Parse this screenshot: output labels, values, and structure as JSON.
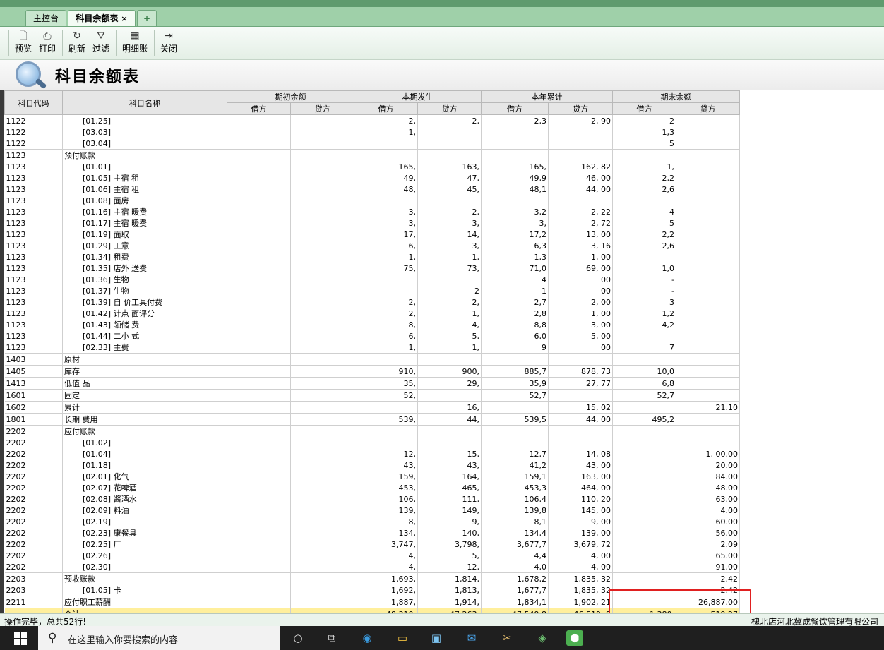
{
  "tabs": [
    {
      "label": "主控台"
    },
    {
      "label": "科目余额表",
      "close": "×"
    },
    {
      "label": "+"
    }
  ],
  "toolbar": {
    "preview": "预览",
    "print": "打印",
    "refresh": "刷新",
    "filter": "过滤",
    "detail": "明细账",
    "close": "关闭"
  },
  "page_title": "科目余额表",
  "table": {
    "head": {
      "code": "科目代码",
      "name": "科目名称",
      "opening": "期初余额",
      "period": "本期发生",
      "ytd": "本年累计",
      "closing": "期末余额",
      "debit": "借方",
      "credit": "贷方"
    },
    "rows": [
      {
        "code": "1122",
        "name": "[01.25]",
        "od": "",
        "oc": "",
        "pd": "2,",
        "pc": "2,",
        "yd": "2,3",
        "yc": "2,   90",
        "cd": "2",
        "cc": ""
      },
      {
        "code": "1122",
        "name": "[03.03]",
        "od": "",
        "oc": "",
        "pd": "1,",
        "pc": "",
        "yd": "",
        "yc": "",
        "cd": "1,3",
        "cc": ""
      },
      {
        "code": "1122",
        "name": "[03.04]",
        "od": "",
        "oc": "",
        "pd": "",
        "pc": "",
        "yd": "",
        "yc": "",
        "cd": "5",
        "cc": ""
      },
      {
        "code": "1123",
        "name": "预付账款",
        "grp": true,
        "od": "",
        "oc": "",
        "pd": "",
        "pc": "",
        "yd": "",
        "yc": "",
        "cd": "",
        "cc": ""
      },
      {
        "code": "1123",
        "name": "[01.01]",
        "od": "",
        "oc": "",
        "pd": "165,",
        "pc": "163,",
        "yd": "165,",
        "yc": "162,   82",
        "cd": "1,",
        "cc": ""
      },
      {
        "code": "1123",
        "name": "[01.05]  主宿    租",
        "od": "",
        "oc": "",
        "pd": "49,",
        "pc": "47,",
        "yd": "49,9",
        "yc": "46,   00",
        "cd": "2,2",
        "cc": ""
      },
      {
        "code": "1123",
        "name": "[01.06]  主宿    租",
        "od": "",
        "oc": "",
        "pd": "48,",
        "pc": "45,",
        "yd": "48,1",
        "yc": "44,   00",
        "cd": "2,6",
        "cc": ""
      },
      {
        "code": "1123",
        "name": "[01.08]  面房",
        "od": "",
        "oc": "",
        "pd": "",
        "pc": "",
        "yd": "",
        "yc": "",
        "cd": "",
        "cc": ""
      },
      {
        "code": "1123",
        "name": "[01.16]  主宿    暖费",
        "od": "",
        "oc": "",
        "pd": "3,",
        "pc": "2,",
        "yd": "3,2",
        "yc": "2,   22",
        "cd": "4",
        "cc": ""
      },
      {
        "code": "1123",
        "name": "[01.17]  主宿    暖费",
        "od": "",
        "oc": "",
        "pd": "3,",
        "pc": "3,",
        "yd": "3,",
        "yc": "2,   72",
        "cd": "5",
        "cc": ""
      },
      {
        "code": "1123",
        "name": "[01.19]  面取",
        "od": "",
        "oc": "",
        "pd": "17,",
        "pc": "14,",
        "yd": "17,2",
        "yc": "13,   00",
        "cd": "2,2",
        "cc": ""
      },
      {
        "code": "1123",
        "name": "[01.29]  工意",
        "od": "",
        "oc": "",
        "pd": "6,",
        "pc": "3,",
        "yd": "6,3",
        "yc": "3,   16",
        "cd": "2,6",
        "cc": ""
      },
      {
        "code": "1123",
        "name": "[01.34]  租费",
        "od": "",
        "oc": "",
        "pd": "1,",
        "pc": "1,",
        "yd": "1,3",
        "yc": "1,   00",
        "cd": "",
        "cc": ""
      },
      {
        "code": "1123",
        "name": "[01.35]  店外    送费",
        "od": "",
        "oc": "",
        "pd": "75,",
        "pc": "73,",
        "yd": "71,0",
        "yc": "69,   00",
        "cd": "1,0",
        "cc": ""
      },
      {
        "code": "1123",
        "name": "[01.36]  生物",
        "od": "",
        "oc": "",
        "pd": "",
        "pc": "",
        "yd": "4",
        "yc": "   00",
        "cd": "-",
        "cc": ""
      },
      {
        "code": "1123",
        "name": "[01.37]  生物",
        "od": "",
        "oc": "",
        "pd": "",
        "pc": "2",
        "yd": "1",
        "yc": "   00",
        "cd": "-",
        "cc": ""
      },
      {
        "code": "1123",
        "name": "[01.39]  自    价工具付费",
        "od": "",
        "oc": "",
        "pd": "2,",
        "pc": "2,",
        "yd": "2,7",
        "yc": "2,   00",
        "cd": "3",
        "cc": ""
      },
      {
        "code": "1123",
        "name": "[01.42]  计点    面评分",
        "od": "",
        "oc": "",
        "pd": "2,",
        "pc": "1,",
        "yd": "2,8",
        "yc": "1,   00",
        "cd": "1,2",
        "cc": ""
      },
      {
        "code": "1123",
        "name": "[01.43]  领储    费",
        "od": "",
        "oc": "",
        "pd": "8,",
        "pc": "4,",
        "yd": "8,8",
        "yc": "3,   00",
        "cd": "4,2",
        "cc": ""
      },
      {
        "code": "1123",
        "name": "[01.44]  二小    式",
        "od": "",
        "oc": "",
        "pd": "6,",
        "pc": "5,",
        "yd": "6,0",
        "yc": "5,   00",
        "cd": "",
        "cc": ""
      },
      {
        "code": "1123",
        "name": "[02.33]  主费",
        "od": "",
        "oc": "",
        "pd": "1,",
        "pc": "1,",
        "yd": "9",
        "yc": "   00",
        "cd": "7",
        "cc": ""
      },
      {
        "code": "1403",
        "name": "原材",
        "grp": true,
        "od": "",
        "oc": "",
        "pd": "",
        "pc": "",
        "yd": "",
        "yc": "",
        "cd": "",
        "cc": ""
      },
      {
        "code": "1405",
        "name": "库存",
        "grp": true,
        "od": "",
        "oc": "",
        "pd": "910,",
        "pc": "900,",
        "yd": "885,7",
        "yc": "878,   73",
        "cd": "10,0",
        "cc": ""
      },
      {
        "code": "1413",
        "name": "低值    品",
        "grp": true,
        "od": "",
        "oc": "",
        "pd": "35,",
        "pc": "29,",
        "yd": "35,9",
        "yc": "27,   77",
        "cd": "6,8",
        "cc": ""
      },
      {
        "code": "1601",
        "name": "固定",
        "grp": true,
        "od": "",
        "oc": "",
        "pd": "52,",
        "pc": "",
        "yd": "52,7",
        "yc": "",
        "cd": "52,7",
        "cc": ""
      },
      {
        "code": "1602",
        "name": "累计",
        "grp": true,
        "od": "",
        "oc": "",
        "pd": "",
        "pc": "16,",
        "yd": "",
        "yc": "15,   02",
        "cd": "",
        "cc": "21.10"
      },
      {
        "code": "1801",
        "name": "长期    费用",
        "grp": true,
        "od": "",
        "oc": "",
        "pd": "539,",
        "pc": "44,",
        "yd": "539,5",
        "yc": "44,   00",
        "cd": "495,2",
        "cc": ""
      },
      {
        "code": "2202",
        "name": "应付账款",
        "grp": true,
        "od": "",
        "oc": "",
        "pd": "",
        "pc": "",
        "yd": "",
        "yc": "",
        "cd": "",
        "cc": ""
      },
      {
        "code": "2202",
        "name": "[01.02]",
        "od": "",
        "oc": "",
        "pd": "",
        "pc": "",
        "yd": "",
        "yc": "",
        "cd": "",
        "cc": ""
      },
      {
        "code": "2202",
        "name": "[01.04]",
        "od": "",
        "oc": "",
        "pd": "12,",
        "pc": "15,",
        "yd": "12,7",
        "yc": "14,   08",
        "cd": "",
        "cc": "1,   00.00"
      },
      {
        "code": "2202",
        "name": "[01.18]",
        "od": "",
        "oc": "",
        "pd": "43,",
        "pc": "43,",
        "yd": "41,2",
        "yc": "43,   00",
        "cd": "",
        "cc": "20.00"
      },
      {
        "code": "2202",
        "name": "[02.01]  化气",
        "od": "",
        "oc": "",
        "pd": "159,",
        "pc": "164,",
        "yd": "159,1",
        "yc": "163,   00",
        "cd": "",
        "cc": "84.00"
      },
      {
        "code": "2202",
        "name": "[02.07]  花啤酒",
        "od": "",
        "oc": "",
        "pd": "453,",
        "pc": "465,",
        "yd": "453,3",
        "yc": "464,   00",
        "cd": "",
        "cc": "48.00"
      },
      {
        "code": "2202",
        "name": "[02.08]  酱酒水",
        "od": "",
        "oc": "",
        "pd": "106,",
        "pc": "111,",
        "yd": "106,4",
        "yc": "110,   20",
        "cd": "",
        "cc": "63.00"
      },
      {
        "code": "2202",
        "name": "[02.09]  料油",
        "od": "",
        "oc": "",
        "pd": "139,",
        "pc": "149,",
        "yd": "139,8",
        "yc": "145,   00",
        "cd": "",
        "cc": "4.00"
      },
      {
        "code": "2202",
        "name": "[02.19]",
        "od": "",
        "oc": "",
        "pd": "8,",
        "pc": "9,",
        "yd": "8,1",
        "yc": "9,   00",
        "cd": "",
        "cc": "60.00"
      },
      {
        "code": "2202",
        "name": "[02.23]  康餐具",
        "od": "",
        "oc": "",
        "pd": "134,",
        "pc": "140,",
        "yd": "134,4",
        "yc": "139,   00",
        "cd": "",
        "cc": "56.00"
      },
      {
        "code": "2202",
        "name": "[02.25]  厂",
        "od": "",
        "oc": "",
        "pd": "3,747,",
        "pc": "3,798,",
        "yd": "3,677,7",
        "yc": "3,679,   72",
        "cd": "",
        "cc": "2.09"
      },
      {
        "code": "2202",
        "name": "[02.26]",
        "od": "",
        "oc": "",
        "pd": "4,",
        "pc": "5,",
        "yd": "4,4",
        "yc": "4,   00",
        "cd": "",
        "cc": "65.00"
      },
      {
        "code": "2202",
        "name": "[02.30]",
        "od": "",
        "oc": "",
        "pd": "4,",
        "pc": "12,",
        "yd": "4,0",
        "yc": "4,   00",
        "cd": "",
        "cc": "91.00"
      },
      {
        "code": "2203",
        "name": "预收账款",
        "grp": true,
        "od": "",
        "oc": "",
        "pd": "1,693,",
        "pc": "1,814,",
        "yd": "1,678,2",
        "yc": "1,835,   32",
        "cd": "",
        "cc": "2.42"
      },
      {
        "code": "2203",
        "name": "[01.05]  卡",
        "od": "",
        "oc": "",
        "pd": "1,692,",
        "pc": "1,813,",
        "yd": "1,677,7",
        "yc": "1,835,   32",
        "cd": "",
        "cc": "2.42"
      },
      {
        "code": "2211",
        "name": "应付职工薪酬",
        "grp": true,
        "od": "",
        "oc": "",
        "pd": "1,887,",
        "pc": "1,914,",
        "yd": "1,834,1",
        "yc": "1,902,   21",
        "cd": "",
        "cc": "26,887.00"
      }
    ],
    "total": {
      "label": "合计",
      "pd": "48,310,",
      "pc": "47,263,",
      "yd": "47,549,8",
      "yc": "46,519,   9",
      "cd": "1,380,",
      "cc": "519.27"
    }
  },
  "status": {
    "left": "操作完毕，总共52行!",
    "right": "槐北店河北冀成餐饮管理有限公司"
  },
  "taskbar": {
    "search_placeholder": "在这里输入你要搜索的内容"
  }
}
